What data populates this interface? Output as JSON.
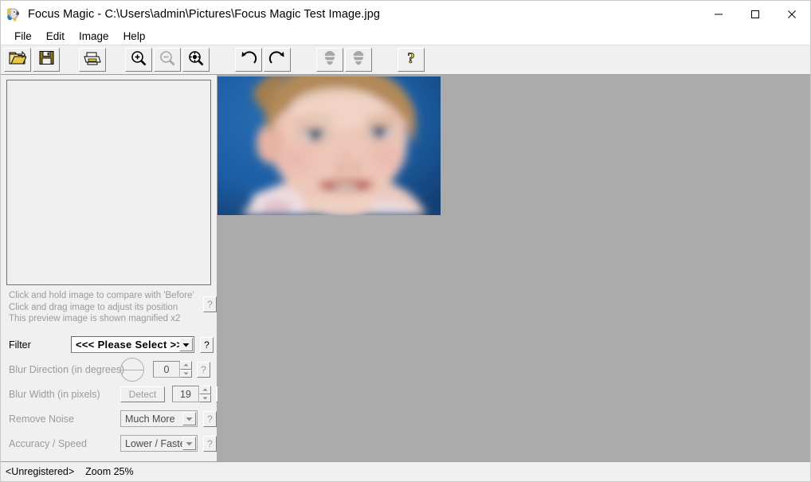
{
  "window": {
    "title": "Focus Magic - C:\\Users\\admin\\Pictures\\Focus Magic Test Image.jpg",
    "app_icon": "parrot-icon",
    "minimize_label": "—",
    "maximize_label": "☐",
    "close_label": "✕"
  },
  "menu": {
    "items": [
      {
        "label": "File"
      },
      {
        "label": "Edit"
      },
      {
        "label": "Image"
      },
      {
        "label": "Help"
      }
    ]
  },
  "toolbar": {
    "buttons": [
      {
        "name": "open-file-button",
        "icon": "open-folder-icon",
        "enabled": true
      },
      {
        "name": "save-file-button",
        "icon": "floppy-save-icon",
        "enabled": true
      },
      {
        "name": "print-button",
        "icon": "printer-icon",
        "enabled": true
      },
      {
        "name": "zoom-in-button",
        "icon": "zoom-in-icon",
        "enabled": true
      },
      {
        "name": "zoom-out-button",
        "icon": "zoom-out-icon",
        "enabled": false
      },
      {
        "name": "zoom-fit-button",
        "icon": "zoom-fit-icon",
        "enabled": true
      },
      {
        "name": "undo-button",
        "icon": "undo-arrow-icon",
        "enabled": true
      },
      {
        "name": "redo-button",
        "icon": "redo-arrow-icon",
        "enabled": true
      },
      {
        "name": "blur-less-button",
        "icon": "stack-layers-icon",
        "enabled": false
      },
      {
        "name": "blur-more-button",
        "icon": "stack-layers-icon",
        "enabled": false
      },
      {
        "name": "help-button",
        "icon": "question-mark-icon",
        "enabled": true
      }
    ]
  },
  "preview": {
    "hints": [
      "Click and hold image to compare with 'Before'",
      "Click and drag image to adjust its position",
      "This preview image is shown magnified x2"
    ],
    "help_label": "?"
  },
  "controls": {
    "filter": {
      "label": "Filter",
      "value": "<<< Please Select >>>",
      "help_label": "?",
      "arrow": "▼"
    },
    "blur_direction": {
      "label": "Blur Direction (in degrees)",
      "value": "0",
      "help_label": "?",
      "dial": "angle-dial",
      "enabled": false
    },
    "blur_width": {
      "label": "Blur Width (in pixels)",
      "detect_label": "Detect",
      "value": "19",
      "help_label": "?",
      "enabled": false
    },
    "remove_noise": {
      "label": "Remove Noise",
      "value": "Much More",
      "help_label": "?",
      "arrow": "▼",
      "enabled": false
    },
    "accuracy_speed": {
      "label": "Accuracy / Speed",
      "value": "Lower   /  Faster",
      "help_label": "?",
      "arrow": "▼",
      "enabled": false
    },
    "spin_up": "▴",
    "spin_dn": "▾"
  },
  "canvas": {
    "image_alt": "blurred-baby-portrait",
    "background_color": "#ababab"
  },
  "statusbar": {
    "registration": "<Unregistered>",
    "zoom": "Zoom 25%"
  },
  "colors": {
    "window_bg": "#f0f0f0",
    "titlebar_bg": "#ffffff",
    "canvas_gray": "#ababab",
    "disabled_text": "#9b9b9b",
    "photo_blue": "#1b5ea6"
  }
}
